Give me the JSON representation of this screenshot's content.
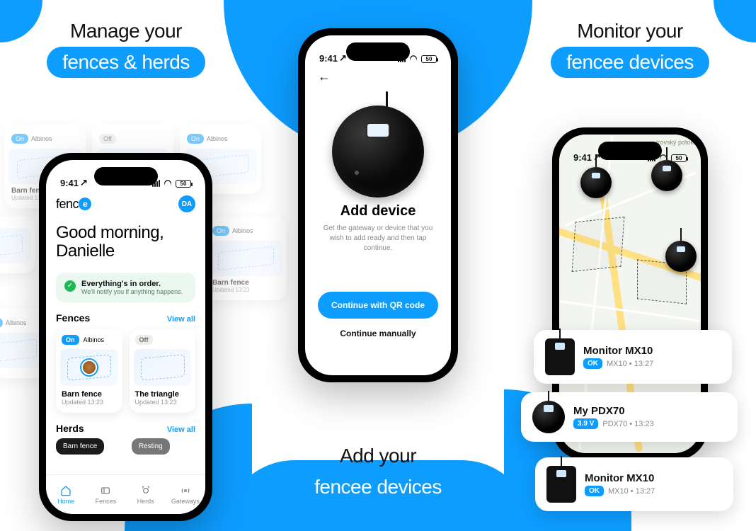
{
  "panel1": {
    "headline_top": "Manage your",
    "headline_pill": "fences & herds",
    "bg_tiles": [
      {
        "badge": "On",
        "label": "Albinos",
        "caption": "Barn fence",
        "sub": "Updated 13:23"
      },
      {
        "badge": "Off",
        "label": "",
        "caption": "",
        "sub": ""
      },
      {
        "badge": "On",
        "label": "Albinos",
        "caption": "",
        "sub": ""
      },
      {
        "badge": "On",
        "label": "Albinos",
        "caption": "Barn fence",
        "sub": "Updated 13:23"
      },
      {
        "badge": "On",
        "label": "Albinos",
        "caption": "",
        "sub": ""
      }
    ],
    "status_time": "9:41",
    "status_batt": "50",
    "brand": "fenc",
    "brand_accent": "e",
    "avatar": "DA",
    "greeting_line1": "Good morning,",
    "greeting_line2": "Danielle",
    "notice_title": "Everything's in order.",
    "notice_sub": "We'll notify you if anything happens.",
    "section_fences": "Fences",
    "section_herds": "Herds",
    "view_all": "View all",
    "fence_cards": [
      {
        "badge": "On",
        "label": "Albinos",
        "name": "Barn fence",
        "updated": "Updated 13:23"
      },
      {
        "badge": "Off",
        "label": "",
        "name": "The triangle",
        "updated": "Updated 13:23"
      }
    ],
    "herd_chips": [
      "Barn fence",
      "Resting"
    ],
    "tabs": [
      {
        "label": "Home"
      },
      {
        "label": "Fences"
      },
      {
        "label": "Herds"
      },
      {
        "label": "Gateways"
      }
    ]
  },
  "panel2": {
    "status_time": "9:41",
    "status_batt": "50",
    "title": "Add device",
    "subtitle": "Get the gateway or device that you wish to add ready and then tap continue.",
    "btn_primary": "Continue with QR code",
    "btn_secondary": "Continue manually",
    "headline_top": "Add your",
    "headline_pill": "fencee devices"
  },
  "panel3": {
    "headline_top": "Monitor your",
    "headline_pill": "fencee devices",
    "status_time": "9:41",
    "status_batt": "50",
    "map_label": "trovský potok",
    "devices": [
      {
        "name": "Monitor MX10",
        "chip": "OK",
        "meta": "MX10 • 13:27"
      },
      {
        "name": "My PDX70",
        "chip": "3.9 V",
        "meta": "PDX70 • 13:23"
      },
      {
        "name": "Monitor MX10",
        "chip": "OK",
        "meta": "MX10 • 13:27"
      }
    ]
  }
}
